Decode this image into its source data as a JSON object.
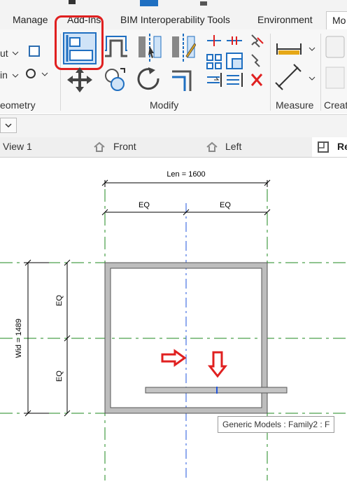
{
  "ribbon": {
    "tabs": [
      {
        "label": "Manage"
      },
      {
        "label": "Add-Ins"
      },
      {
        "label": "BIM Interoperability Tools"
      },
      {
        "label": "Environment"
      },
      {
        "label": "Mo"
      }
    ],
    "panels": {
      "geometry": "eometry",
      "modify": "Modify",
      "measure": "Measure",
      "create": "Creat"
    },
    "left_tools": [
      "ut",
      "in"
    ]
  },
  "view_tabs": [
    {
      "label": "View 1"
    },
    {
      "label": "Front"
    },
    {
      "label": "Left"
    },
    {
      "label": "Re"
    }
  ],
  "drawing": {
    "len_dimension": "Len = 1600",
    "eq_label": "EQ",
    "wid_dimension": "Wid = 1489"
  },
  "tooltip": "Generic Models : Family2 : F",
  "colors": {
    "highlight": "#e02020",
    "ref_plane_green": "#1f8a1f",
    "center_blue": "#2255dd",
    "wall_gray": "#bdbdbd",
    "accent_blue": "#1f6fc1"
  },
  "icons": [
    "align-icon",
    "offset-icon",
    "mirror-pick-axis-icon",
    "mirror-draw-axis-icon",
    "split-element-icon",
    "pin-icon",
    "move-icon",
    "copy-icon",
    "rotate-icon",
    "trim-extend-icon",
    "array-icon",
    "scale-icon",
    "unpin-icon",
    "delete-icon",
    "aligned-dimension-icon",
    "measure-icon"
  ]
}
